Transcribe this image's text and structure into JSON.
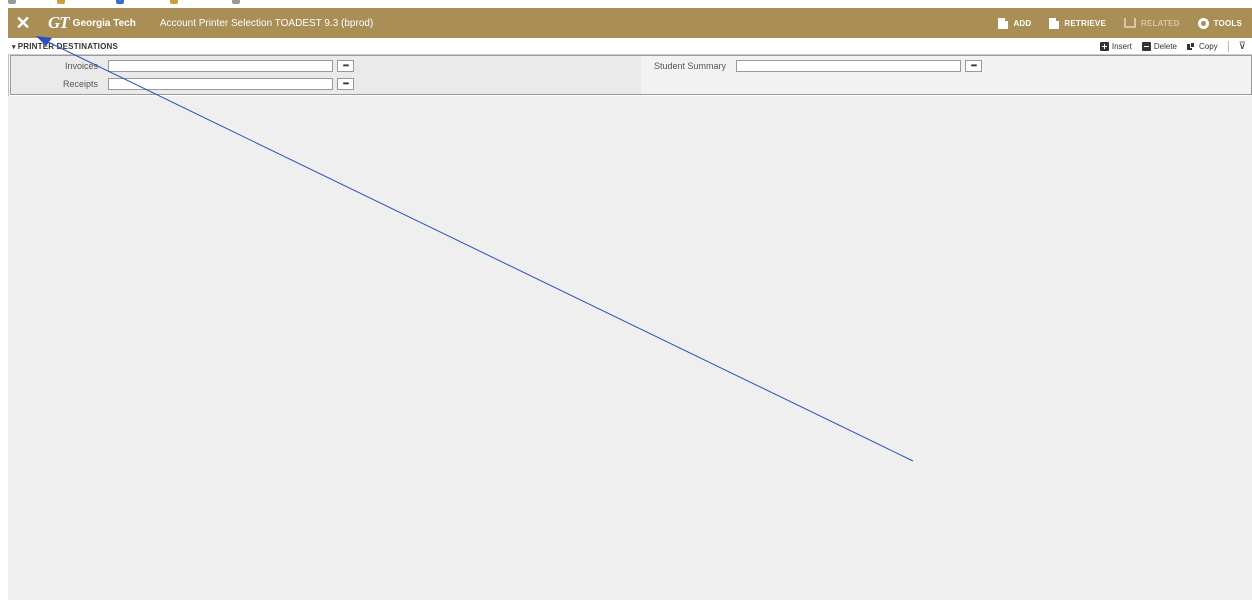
{
  "header": {
    "close_label": "✕",
    "logo_mark": "GT",
    "logo_text": "Georgia Tech",
    "page_title": "Account Printer Selection TOADEST 9.3 (bprod)",
    "actions": [
      {
        "label": "ADD",
        "icon": "add-doc-icon",
        "enabled": true
      },
      {
        "label": "RETRIEVE",
        "icon": "retrieve-doc-icon",
        "enabled": true
      },
      {
        "label": "RELATED",
        "icon": "related-tree-icon",
        "enabled": false
      },
      {
        "label": "TOOLS",
        "icon": "gear-icon",
        "enabled": true
      }
    ]
  },
  "section": {
    "title": "PRINTER DESTINATIONS",
    "tools": {
      "insert": "Insert",
      "delete": "Delete",
      "copy": "Copy"
    }
  },
  "form": {
    "invoices_label": "Invoices",
    "invoices_value": "",
    "receipts_label": "Receipts",
    "receipts_value": "",
    "student_summary_label": "Student Summary",
    "student_summary_value": "",
    "lookup_glyph": "•••"
  },
  "colors": {
    "header_bg": "#a98e55",
    "content_bg": "#efefef",
    "annotation_line": "#2a52be"
  }
}
